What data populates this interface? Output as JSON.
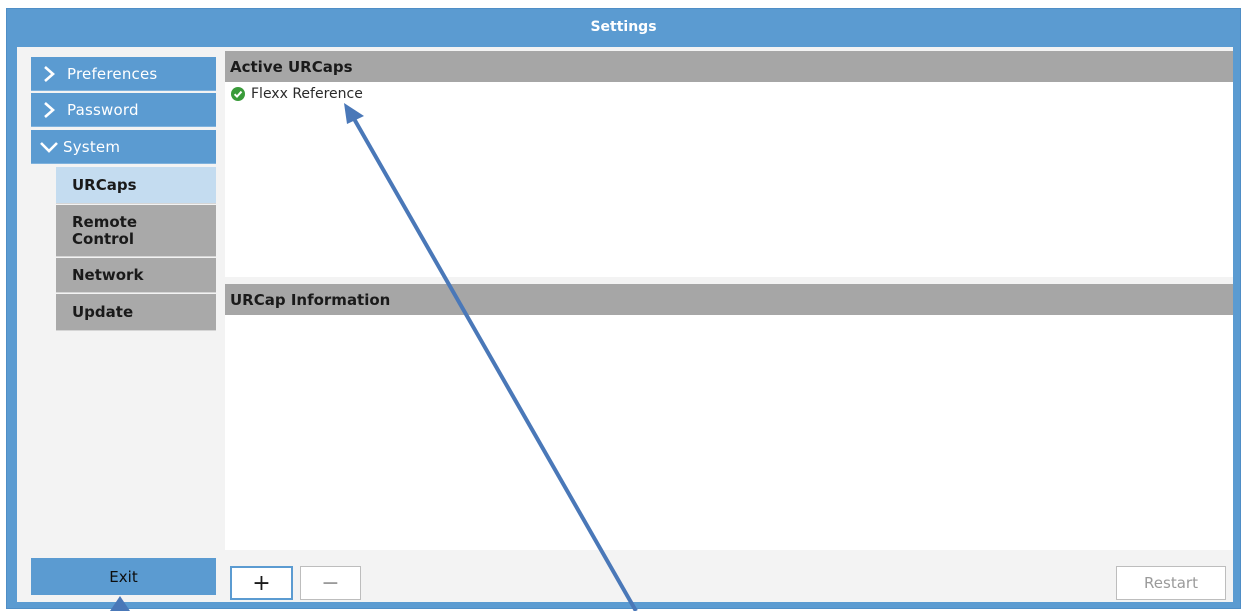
{
  "window": {
    "title": "Settings"
  },
  "sidebar": {
    "sections": [
      {
        "label": "Preferences",
        "expanded": false,
        "icon": "chevron-right-icon"
      },
      {
        "label": "Password",
        "expanded": false,
        "icon": "chevron-right-icon"
      },
      {
        "label": "System",
        "expanded": true,
        "icon": "chevron-down-icon"
      }
    ],
    "system_items": [
      {
        "label": "URCaps",
        "active": true
      },
      {
        "label": "Remote Control",
        "active": false
      },
      {
        "label": "Network",
        "active": false
      },
      {
        "label": "Update",
        "active": false
      }
    ],
    "exit_label": "Exit"
  },
  "main": {
    "active_header": "Active URCaps",
    "urcaps": [
      {
        "name": "Flexx Reference",
        "status": "active",
        "icon": "check-circle-icon"
      }
    ],
    "info_header": "URCap Information",
    "info_text": ""
  },
  "toolbar": {
    "add_label": "+",
    "remove_label": "−",
    "restart_label": "Restart"
  },
  "colors": {
    "accent": "#5b9bd1",
    "active_item": "#c4dcf0",
    "inactive_item": "#a9a9a9",
    "header_gray": "#a6a6a6",
    "status_ok": "#3a9b3a",
    "annotation_arrow": "#4a78b8"
  }
}
